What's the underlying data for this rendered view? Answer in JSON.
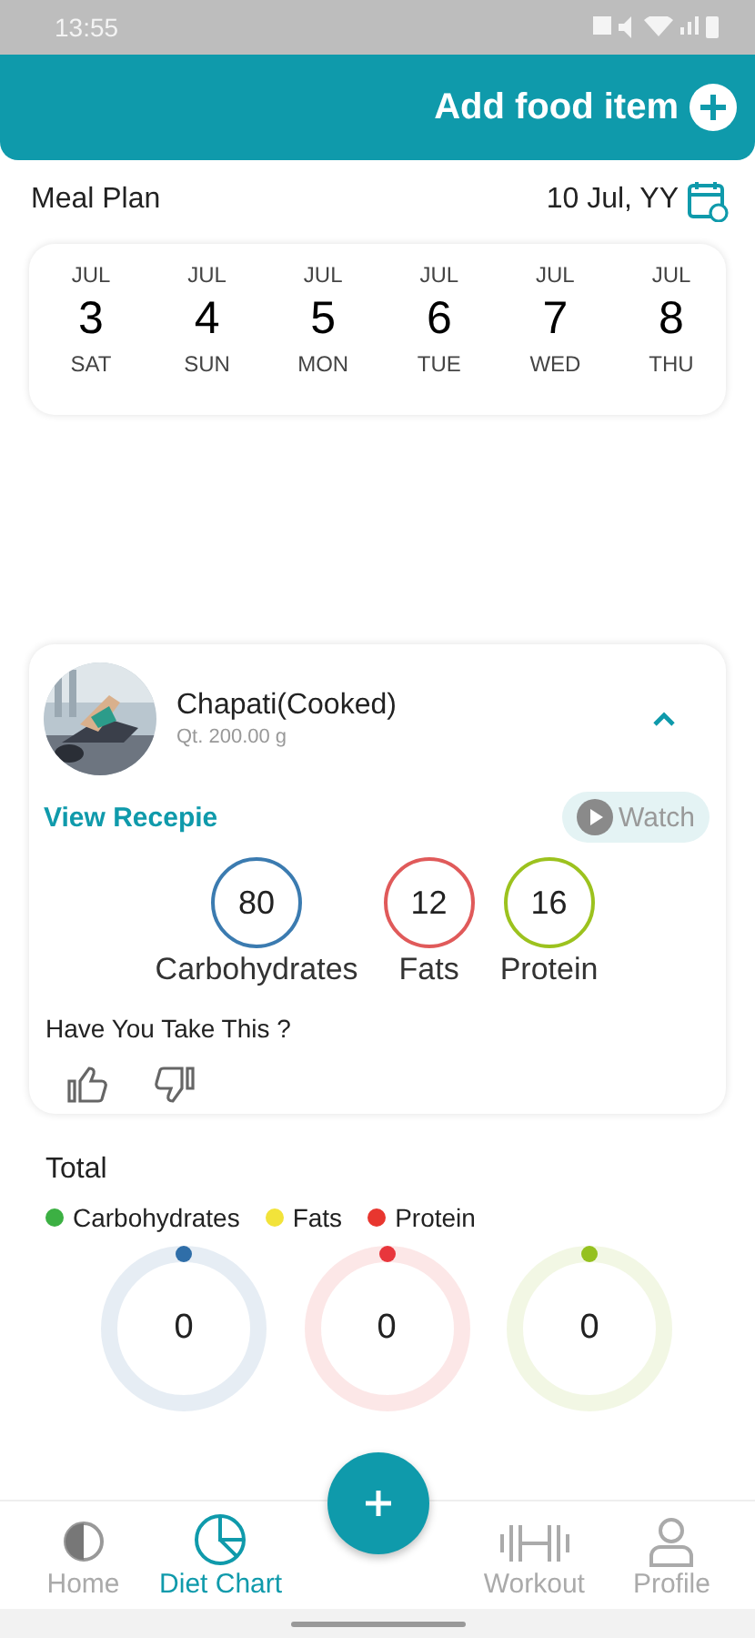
{
  "status_bar": {
    "time": "13:55"
  },
  "header": {
    "action": "Add food item"
  },
  "meal_plan": {
    "title": "Meal Plan",
    "date": "10 Jul, YY"
  },
  "days": [
    {
      "month": "JUL",
      "day": "3",
      "weekday": "SAT"
    },
    {
      "month": "JUL",
      "day": "4",
      "weekday": "SUN"
    },
    {
      "month": "JUL",
      "day": "5",
      "weekday": "MON"
    },
    {
      "month": "JUL",
      "day": "6",
      "weekday": "TUE"
    },
    {
      "month": "JUL",
      "day": "7",
      "weekday": "WED"
    },
    {
      "month": "JUL",
      "day": "8",
      "weekday": "THU"
    }
  ],
  "food": {
    "name": "Chapati(Cooked)",
    "quantity": "Qt. 200.00 g",
    "expanded": true,
    "recipe_link": "View Recepie",
    "watch": "Watch",
    "question": "Have You Take This ?",
    "macros": [
      {
        "value": "80",
        "label": "Carbohydrates",
        "color": "#3b7bb0"
      },
      {
        "value": "12",
        "label": "Fats",
        "color": "#e05a5a"
      },
      {
        "value": "16",
        "label": "Protein",
        "color": "#9cc21e"
      }
    ]
  },
  "total": {
    "title": "Total",
    "legend": [
      {
        "label": "Carbohydrates",
        "color": "#3cb043"
      },
      {
        "label": "Fats",
        "color": "#f2e33a"
      },
      {
        "label": "Protein",
        "color": "#e8362f"
      }
    ],
    "rings": [
      {
        "value": "0",
        "color": "#2f6ea8"
      },
      {
        "value": "0",
        "color": "#e8363c"
      },
      {
        "value": "0",
        "color": "#95c11f"
      }
    ]
  },
  "nav": [
    {
      "label": "Home",
      "kind": "home",
      "selected": false
    },
    {
      "label": "Diet Chart",
      "kind": "chart",
      "selected": true
    },
    {
      "label": "Workout",
      "kind": "workout",
      "selected": false
    },
    {
      "label": "Profile",
      "kind": "profile",
      "selected": false
    }
  ]
}
